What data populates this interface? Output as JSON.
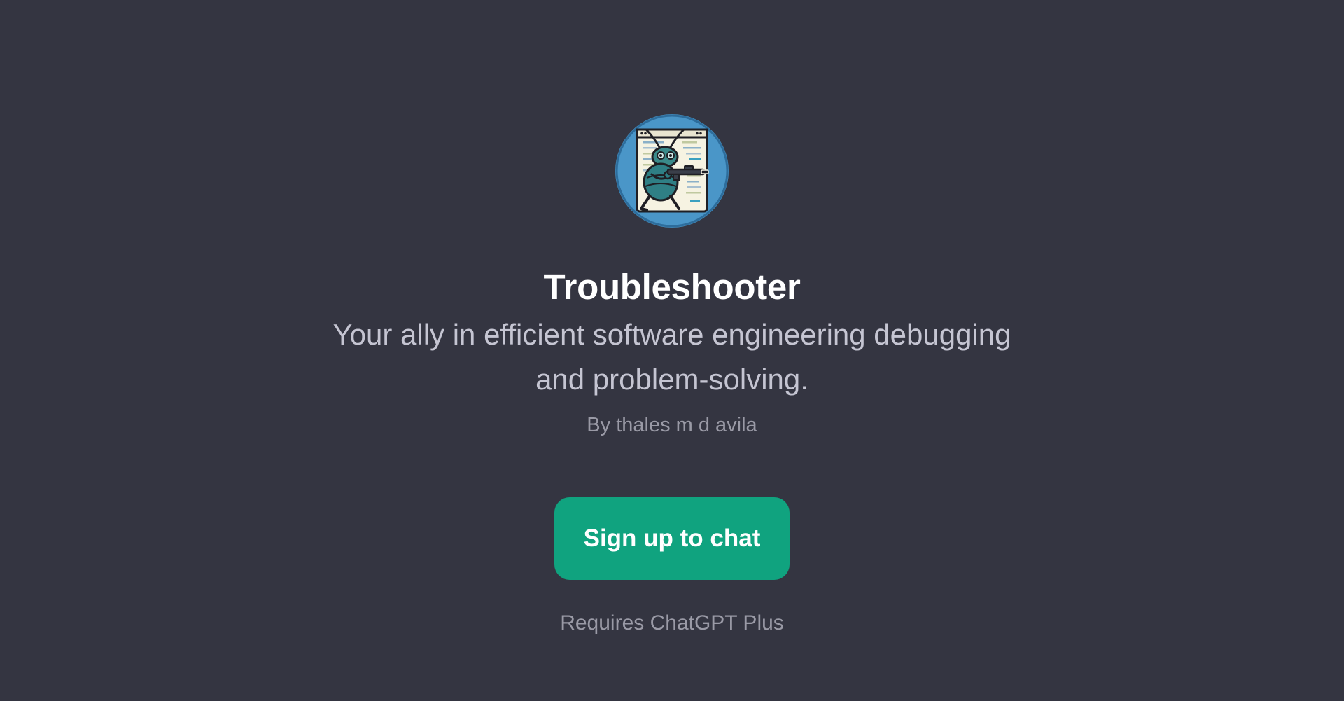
{
  "gpt": {
    "name": "Troubleshooter",
    "description": "Your ally in efficient software engineering debugging and problem-solving.",
    "author": "By thales m d avila",
    "avatar_icon": "bug-debugger-avatar-icon"
  },
  "actions": {
    "signup_label": "Sign up to chat"
  },
  "footer": {
    "requirement": "Requires ChatGPT Plus"
  },
  "colors": {
    "background": "#343541",
    "accent": "#10a37f",
    "title": "#ffffff",
    "subtitle": "#c5c5d2",
    "muted": "#9a9aa6"
  }
}
